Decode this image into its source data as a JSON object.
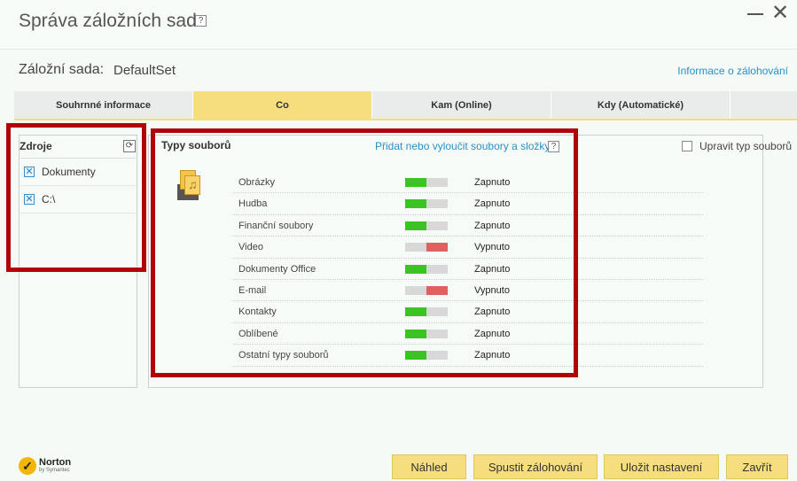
{
  "window": {
    "title": "Správa záložních sad",
    "help_glyph": "?",
    "minimize_glyph": "—",
    "close_glyph": "✕"
  },
  "backup_set": {
    "label": "Záložní sada:",
    "name": "DefaultSet",
    "info_link": "Informace o zálohování"
  },
  "tabs": [
    {
      "label": "Souhrnné informace",
      "active": false
    },
    {
      "label": "Co",
      "active": true
    },
    {
      "label": "Kam (Online)",
      "active": false
    },
    {
      "label": "Kdy (Automatické)",
      "active": false
    }
  ],
  "sources": {
    "title": "Zdroje",
    "refresh_icon": "refresh-icon",
    "items": [
      {
        "label": "Dokumenty",
        "checked": true
      },
      {
        "label": "C:\\",
        "checked": true
      }
    ]
  },
  "file_types": {
    "title": "Typy souborů",
    "add_exclude_link": "Přidat nebo vyloučit soubory a složky",
    "help_glyph": "?",
    "edit_type_label": "Upravit typ souborů",
    "edit_type_checked": false,
    "colors": {
      "on": "#3bc324",
      "off": "#e06060",
      "track": "#d8d8d8"
    },
    "items": [
      {
        "name": "Obrázky",
        "enabled": true,
        "status": "Zapnuto"
      },
      {
        "name": "Hudba",
        "enabled": true,
        "status": "Zapnuto"
      },
      {
        "name": "Finanční soubory",
        "enabled": true,
        "status": "Zapnuto"
      },
      {
        "name": "Video",
        "enabled": false,
        "status": "Vypnuto"
      },
      {
        "name": "Dokumenty Office",
        "enabled": true,
        "status": "Zapnuto"
      },
      {
        "name": "E-mail",
        "enabled": false,
        "status": "Vypnuto"
      },
      {
        "name": "Kontakty",
        "enabled": true,
        "status": "Zapnuto"
      },
      {
        "name": "Oblíbené",
        "enabled": true,
        "status": "Zapnuto"
      },
      {
        "name": "Ostatní typy souborů",
        "enabled": true,
        "status": "Zapnuto"
      }
    ]
  },
  "footer": {
    "brand": "Norton",
    "brand_sub": "by Symantec",
    "buttons": {
      "preview": "Náhled",
      "run_backup": "Spustit zálohování",
      "save_settings": "Uložit nastavení",
      "close": "Zavřít"
    }
  },
  "highlight_color": "#b1030a"
}
